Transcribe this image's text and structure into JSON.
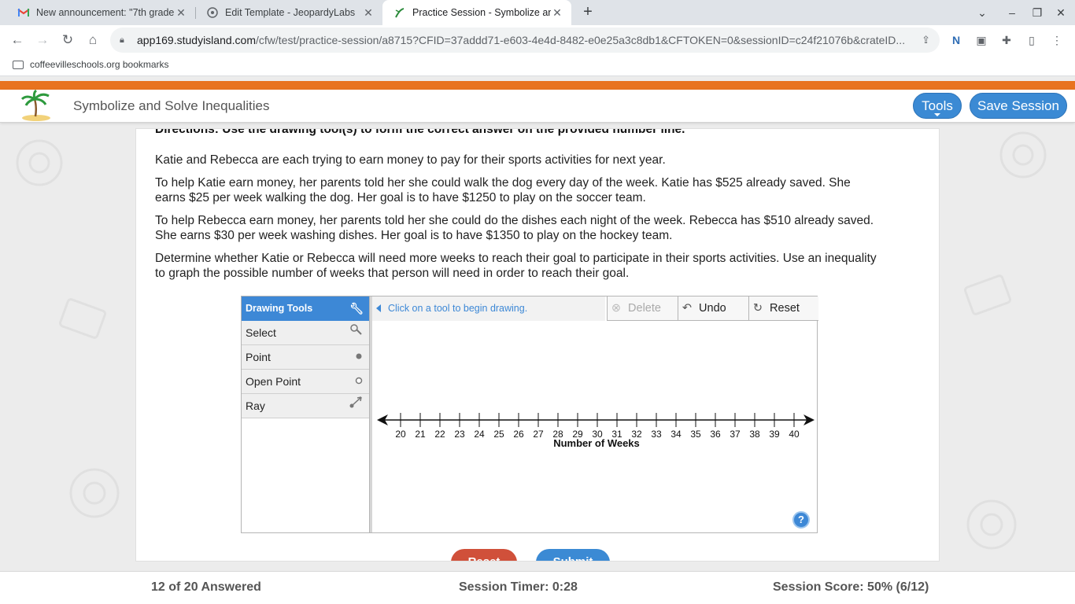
{
  "browser": {
    "tabs": [
      {
        "title": "New announcement: \"7th grade",
        "icon": "gmail-icon"
      },
      {
        "title": "Edit Template - JeopardyLabs",
        "icon": "jeopardylabs-icon"
      },
      {
        "title": "Practice Session - Symbolize and",
        "icon": "studyisland-icon",
        "active": true
      }
    ],
    "url_host": "app169.studyisland.com",
    "url_path": "/cfw/test/practice-session/a8715?CFID=37addd71-e603-4e4d-8482-e0e25a3c8db1&CFTOKEN=0&sessionID=c24f21076b&crateID...",
    "bookmark": "coffeevilleschools.org bookmarks"
  },
  "app": {
    "title": "Symbolize and Solve Inequalities",
    "tools_label": "Tools",
    "save_label": "Save Session",
    "accent": "#3b8ad4",
    "band_color": "#e8731f"
  },
  "question": {
    "directions": "Directions: Use the drawing tool(s) to form the correct answer on the provided number line.",
    "paragraphs": [
      "Katie and Rebecca are each trying to earn money to pay for their sports activities for next year.",
      "To help Katie earn money, her parents told her she could walk the dog every day of the week. Katie has $525 already saved. She earns $25 per week walking the dog. Her goal is to have $1250 to play on the soccer team.",
      "To help Rebecca earn money, her parents told her she could do the dishes each night of the week. Rebecca has $510 already saved. She earns $30 per week washing dishes. Her goal is to have $1350 to play on the hockey team.",
      "Determine whether Katie or Rebecca will need more weeks to reach their goal to participate in their sports activities. Use an inequality to graph the possible number of weeks that person will need in order to reach their goal."
    ]
  },
  "drawing": {
    "header": "Drawing Tools",
    "tools": [
      {
        "label": "Select",
        "icon": "select-cursor-icon"
      },
      {
        "label": "Point",
        "icon": "point-icon"
      },
      {
        "label": "Open Point",
        "icon": "open-point-icon"
      },
      {
        "label": "Ray",
        "icon": "ray-icon"
      }
    ],
    "message": "Click on a tool to begin drawing.",
    "delete_label": "Delete",
    "undo_label": "Undo",
    "reset_label": "Reset",
    "help_label": "?",
    "axis_label": "Number of Weeks",
    "ticks": [
      "20",
      "21",
      "22",
      "23",
      "24",
      "25",
      "26",
      "27",
      "28",
      "29",
      "30",
      "31",
      "32",
      "33",
      "34",
      "35",
      "36",
      "37",
      "38",
      "39",
      "40"
    ]
  },
  "actions": {
    "reset_label": "Reset",
    "submit_label": "Submit"
  },
  "status": {
    "answered": "12 of 20 Answered",
    "timer": "Session Timer: 0:28",
    "score": "Session Score: 50% (6/12)"
  }
}
